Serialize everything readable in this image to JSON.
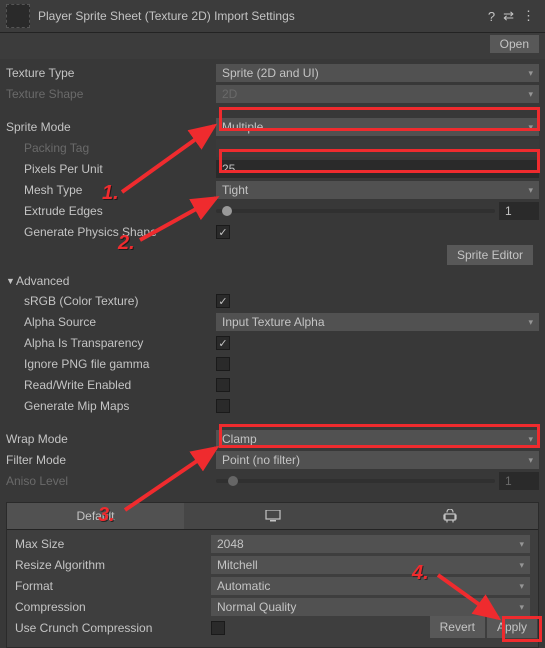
{
  "header": {
    "title": "Player Sprite Sheet (Texture 2D) Import Settings",
    "open_label": "Open"
  },
  "fields": {
    "texture_type": {
      "label": "Texture Type",
      "value": "Sprite (2D and UI)"
    },
    "texture_shape": {
      "label": "Texture Shape",
      "value": "2D"
    },
    "sprite_mode": {
      "label": "Sprite Mode",
      "value": "Multiple"
    },
    "packing_tag": {
      "label": "Packing Tag",
      "value": ""
    },
    "pixels_per_unit": {
      "label": "Pixels Per Unit",
      "value": "25"
    },
    "mesh_type": {
      "label": "Mesh Type",
      "value": "Tight"
    },
    "extrude_edges": {
      "label": "Extrude Edges",
      "value": "1"
    },
    "generate_physics_shape": {
      "label": "Generate Physics Shape",
      "checked": true
    },
    "sprite_editor_label": "Sprite Editor",
    "advanced_label": "Advanced",
    "srgb": {
      "label": "sRGB (Color Texture)",
      "checked": true
    },
    "alpha_source": {
      "label": "Alpha Source",
      "value": "Input Texture Alpha"
    },
    "alpha_is_transparency": {
      "label": "Alpha Is Transparency",
      "checked": true
    },
    "ignore_png_gamma": {
      "label": "Ignore PNG file gamma",
      "checked": false
    },
    "read_write": {
      "label": "Read/Write Enabled",
      "checked": false
    },
    "generate_mip_maps": {
      "label": "Generate Mip Maps",
      "checked": false
    },
    "wrap_mode": {
      "label": "Wrap Mode",
      "value": "Clamp"
    },
    "filter_mode": {
      "label": "Filter Mode",
      "value": "Point (no filter)"
    },
    "aniso_level": {
      "label": "Aniso Level",
      "value": "1"
    }
  },
  "platform": {
    "default_tab": "Default",
    "max_size": {
      "label": "Max Size",
      "value": "2048"
    },
    "resize_algorithm": {
      "label": "Resize Algorithm",
      "value": "Mitchell"
    },
    "format": {
      "label": "Format",
      "value": "Automatic"
    },
    "compression": {
      "label": "Compression",
      "value": "Normal Quality"
    },
    "use_crunch": {
      "label": "Use Crunch Compression",
      "checked": false
    }
  },
  "buttons": {
    "revert": "Revert",
    "apply": "Apply"
  },
  "annotations": {
    "n1": "1.",
    "n2": "2.",
    "n3": "3.",
    "n4": "4."
  }
}
